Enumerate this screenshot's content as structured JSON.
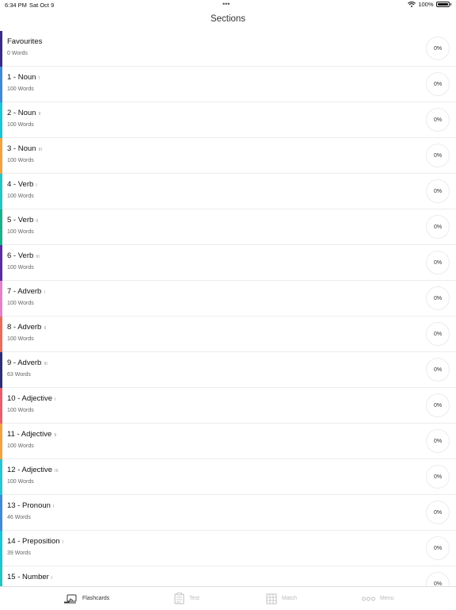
{
  "status": {
    "time": "6:34 PM",
    "date": "Sat Oct 9",
    "battery": "100%",
    "wifi_icon": "wifi-icon",
    "battery_icon": "battery-icon"
  },
  "nav": {
    "title": "Sections"
  },
  "sections": [
    {
      "name": "Favourites",
      "roman": "",
      "count": "0 Words",
      "progress": "0%",
      "color": "#3a2a8f"
    },
    {
      "name": "1 - Noun",
      "roman": "I",
      "count": "100 Words",
      "progress": "0%",
      "color": "#3b8be0"
    },
    {
      "name": "2 - Noun",
      "roman": "II",
      "count": "100 Words",
      "progress": "0%",
      "color": "#14c8d8"
    },
    {
      "name": "3 - Noun",
      "roman": "III",
      "count": "100 Words",
      "progress": "0%",
      "color": "#f5a23a"
    },
    {
      "name": "4 - Verb",
      "roman": "I",
      "count": "100 Words",
      "progress": "0%",
      "color": "#1fc8c8"
    },
    {
      "name": "5 - Verb",
      "roman": "II",
      "count": "100 Words",
      "progress": "0%",
      "color": "#12b58a"
    },
    {
      "name": "6 - Verb",
      "roman": "III",
      "count": "100 Words",
      "progress": "0%",
      "color": "#5b2aa8"
    },
    {
      "name": "7 - Adverb",
      "roman": "I",
      "count": "100 Words",
      "progress": "0%",
      "color": "#e77fcf"
    },
    {
      "name": "8 - Adverb",
      "roman": "II",
      "count": "100 Words",
      "progress": "0%",
      "color": "#f06a5a"
    },
    {
      "name": "9 - Adverb",
      "roman": "III",
      "count": "63 Words",
      "progress": "0%",
      "color": "#2b2f7a"
    },
    {
      "name": "10 - Adjective",
      "roman": "I",
      "count": "100 Words",
      "progress": "0%",
      "color": "#ee5b6b"
    },
    {
      "name": "11 - Adjective",
      "roman": "II",
      "count": "100 Words",
      "progress": "0%",
      "color": "#f5a23a"
    },
    {
      "name": "12 - Adjective",
      "roman": "III",
      "count": "100 Words",
      "progress": "0%",
      "color": "#20c9d6"
    },
    {
      "name": "13 - Pronoun",
      "roman": "I",
      "count": "46 Words",
      "progress": "0%",
      "color": "#3b8be0"
    },
    {
      "name": "14 - Preposition",
      "roman": "I",
      "count": "39 Words",
      "progress": "0%",
      "color": "#14c8d8"
    },
    {
      "name": "15 - Number",
      "roman": "I",
      "count": "",
      "progress": "0%",
      "color": "#1fc8c8"
    }
  ],
  "tabs": [
    {
      "label": "Flashcards",
      "icon": "flashcards-icon",
      "active": true
    },
    {
      "label": "Test",
      "icon": "test-icon",
      "active": false
    },
    {
      "label": "Match",
      "icon": "match-grid-icon",
      "active": false
    },
    {
      "label": "Menu",
      "icon": "menu-dots-icon",
      "active": false
    }
  ]
}
